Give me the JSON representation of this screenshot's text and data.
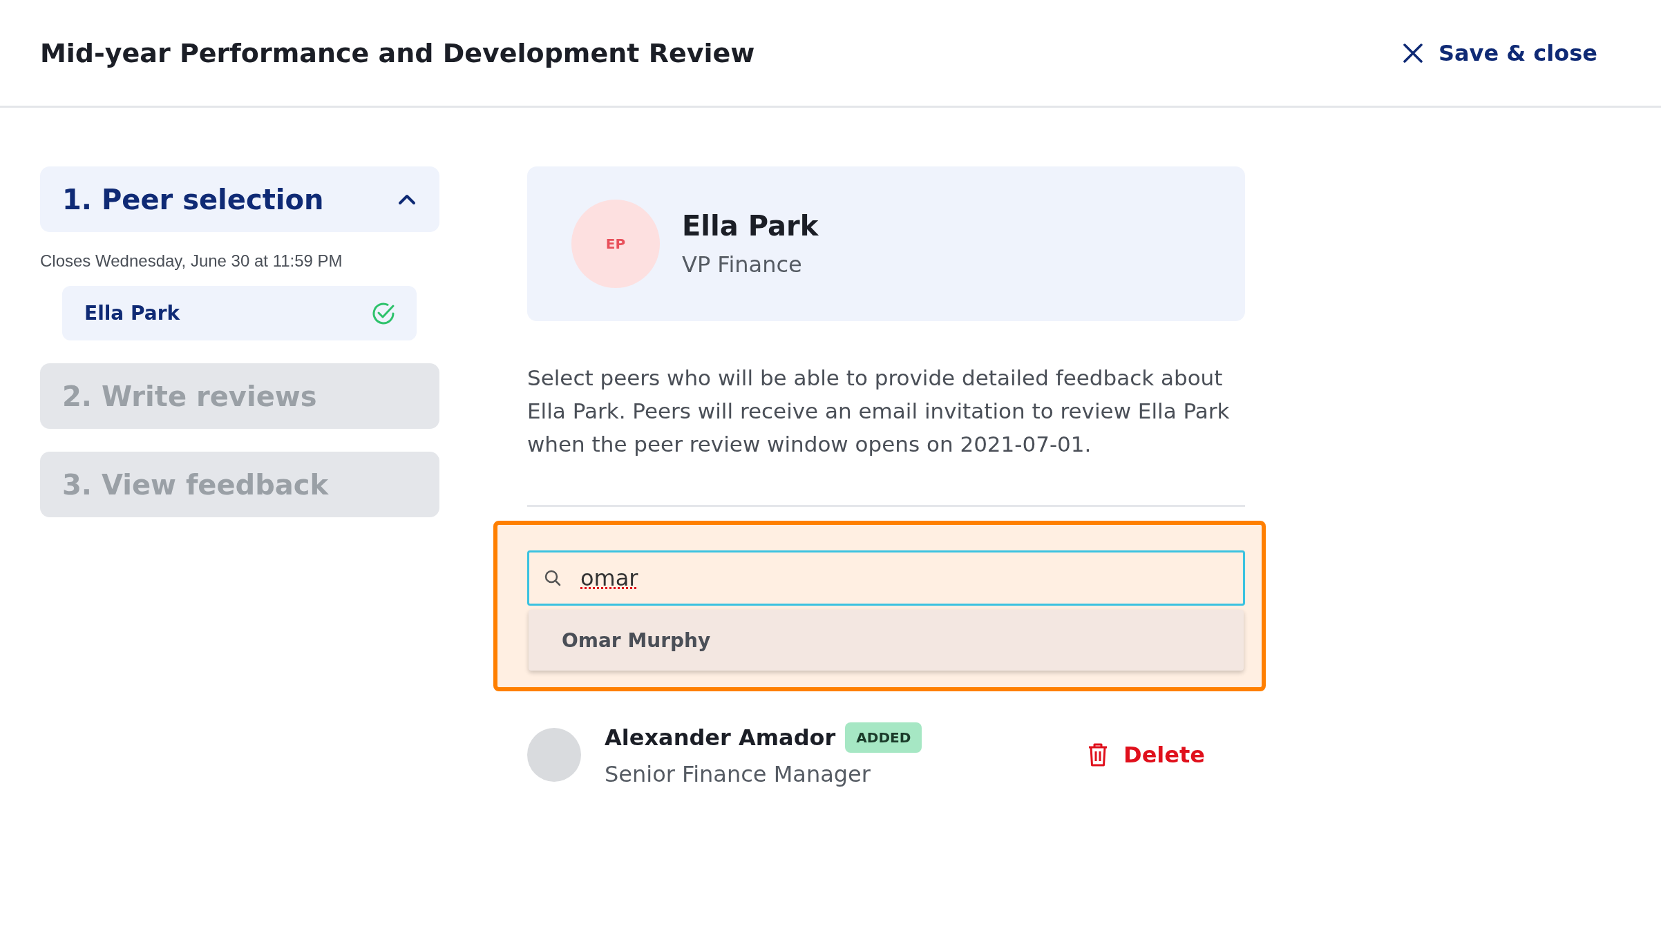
{
  "header": {
    "title": "Mid-year Performance and Development Review",
    "close_label": "Save & close"
  },
  "steps": [
    {
      "label": "1. Peer selection",
      "expanded": true,
      "disabled": false,
      "deadline": "Closes Wednesday, June 30 at 11:59 PM",
      "items": [
        {
          "label": "Ella Park",
          "done": true
        }
      ]
    },
    {
      "label": "2. Write reviews",
      "expanded": false,
      "disabled": true
    },
    {
      "label": "3. View feedback",
      "expanded": false,
      "disabled": true
    }
  ],
  "profile": {
    "initials": "EP",
    "name": "Ella Park",
    "role": "VP Finance"
  },
  "description": "Select peers who will be able to provide detailed feedback about Ella Park. Peers will receive an email invitation to review Ella Park when the peer review window opens on 2021-07-01.",
  "search": {
    "value": "omar",
    "suggestions": [
      "Omar Murphy"
    ]
  },
  "peers": [
    {
      "name": "Alexander Amador",
      "badge": "ADDED",
      "role": "Senior Finance Manager",
      "action": "Delete"
    }
  ]
}
